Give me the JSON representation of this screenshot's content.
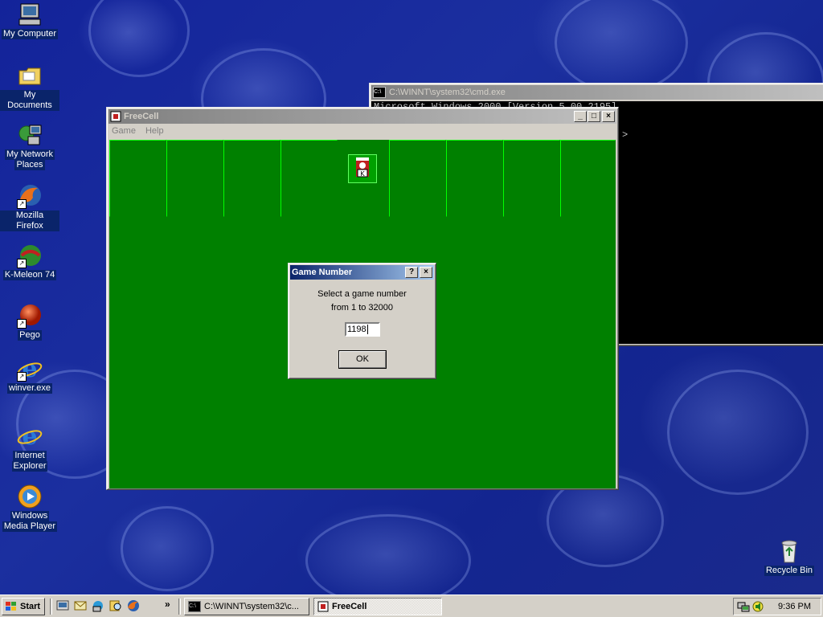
{
  "desktop": {
    "icons": [
      {
        "label1": "My Computer",
        "label2": ""
      },
      {
        "label1": "My Documents",
        "label2": ""
      },
      {
        "label1": "My Network",
        "label2": "Places"
      },
      {
        "label1": "Mozilla Firefox",
        "label2": ""
      },
      {
        "label1": "K-Meleon 74",
        "label2": ""
      },
      {
        "label1": "Pego",
        "label2": ""
      },
      {
        "label1": "winver.exe",
        "label2": ""
      },
      {
        "label1": "Internet",
        "label2": "Explorer"
      },
      {
        "label1": "Windows",
        "label2": "Media Player"
      },
      {
        "label1": "Recycle Bin",
        "label2": ""
      }
    ]
  },
  "cmd": {
    "title": "C:\\WINNT\\system32\\cmd.exe",
    "line1": "Microsoft Windows 2000 [Version 5.00.2195]",
    "prompt_tail": ">"
  },
  "freecell": {
    "title": "FreeCell",
    "menu": [
      "Game",
      "Help"
    ],
    "colors": {
      "felt": "#008000",
      "cell_light": "#00ff00"
    }
  },
  "dialog": {
    "title": "Game Number",
    "help_btn": "?",
    "close_btn": "×",
    "line1": "Select a game number",
    "line2": "from 1 to 32000",
    "input_value": "1198",
    "ok_label": "OK"
  },
  "taskbar": {
    "start_label": "Start",
    "chevron": "»",
    "tasks": [
      {
        "label": "C:\\WINNT\\system32\\c...",
        "icon": "cmd-icon"
      },
      {
        "label": "FreeCell",
        "icon": "freecell-icon"
      }
    ],
    "clock": "9:36 PM"
  }
}
